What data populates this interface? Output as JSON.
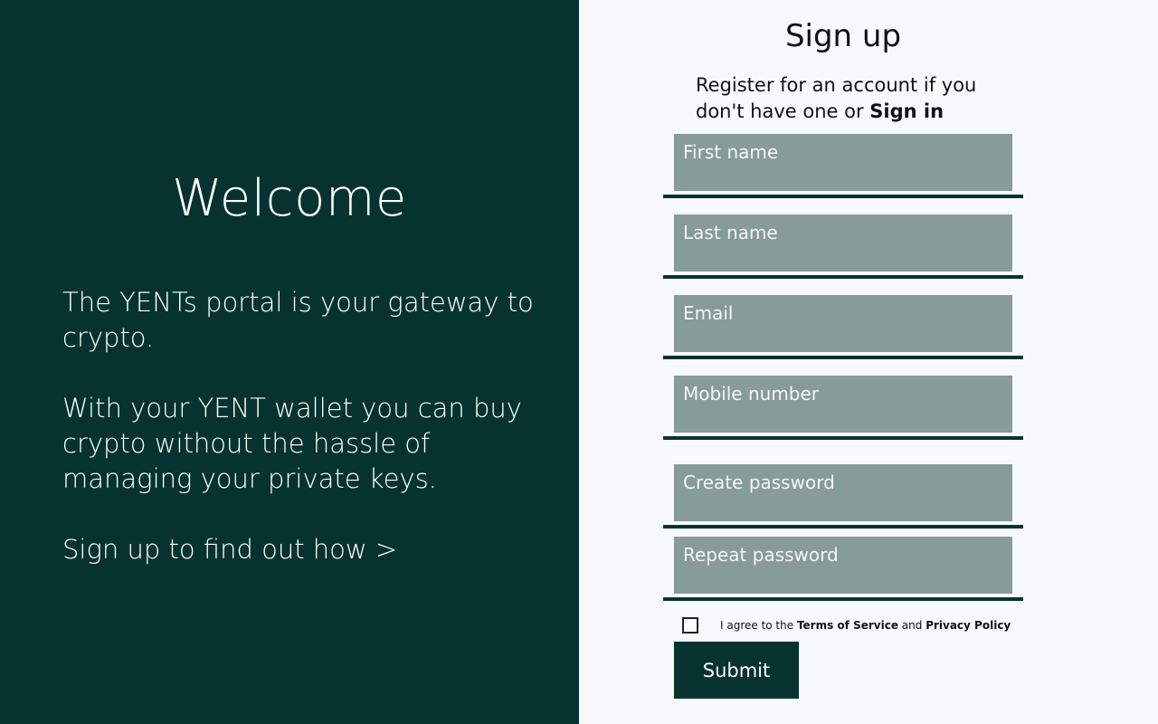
{
  "left": {
    "welcome": "Welcome",
    "intro_1": "The YENTs portal is your gateway to crypto.",
    "intro_2": "With your YENT wallet you can buy crypto without the hassle of managing your private keys.",
    "cta": "Sign up to find out how >"
  },
  "signup": {
    "title": "Sign up",
    "subtitle_prefix": "Register for an account if you don't have one or ",
    "signin_link": "Sign in",
    "fields": {
      "first_name": {
        "placeholder": "First name",
        "value": ""
      },
      "last_name": {
        "placeholder": "Last name",
        "value": ""
      },
      "email": {
        "placeholder": "Email",
        "value": ""
      },
      "mobile": {
        "placeholder": "Mobile number",
        "value": ""
      },
      "password": {
        "placeholder": "Create password",
        "value": ""
      },
      "repeat_password": {
        "placeholder": "Repeat password",
        "value": ""
      }
    },
    "agree": {
      "checked": false,
      "prefix": "I agree to the ",
      "terms": "Terms of Service",
      "and": " and ",
      "privacy": "Privacy Policy"
    },
    "submit": "Submit"
  },
  "colors": {
    "dark_green": "#063330",
    "field_bg": "#879b98",
    "page_bg": "#f7f9fb"
  }
}
